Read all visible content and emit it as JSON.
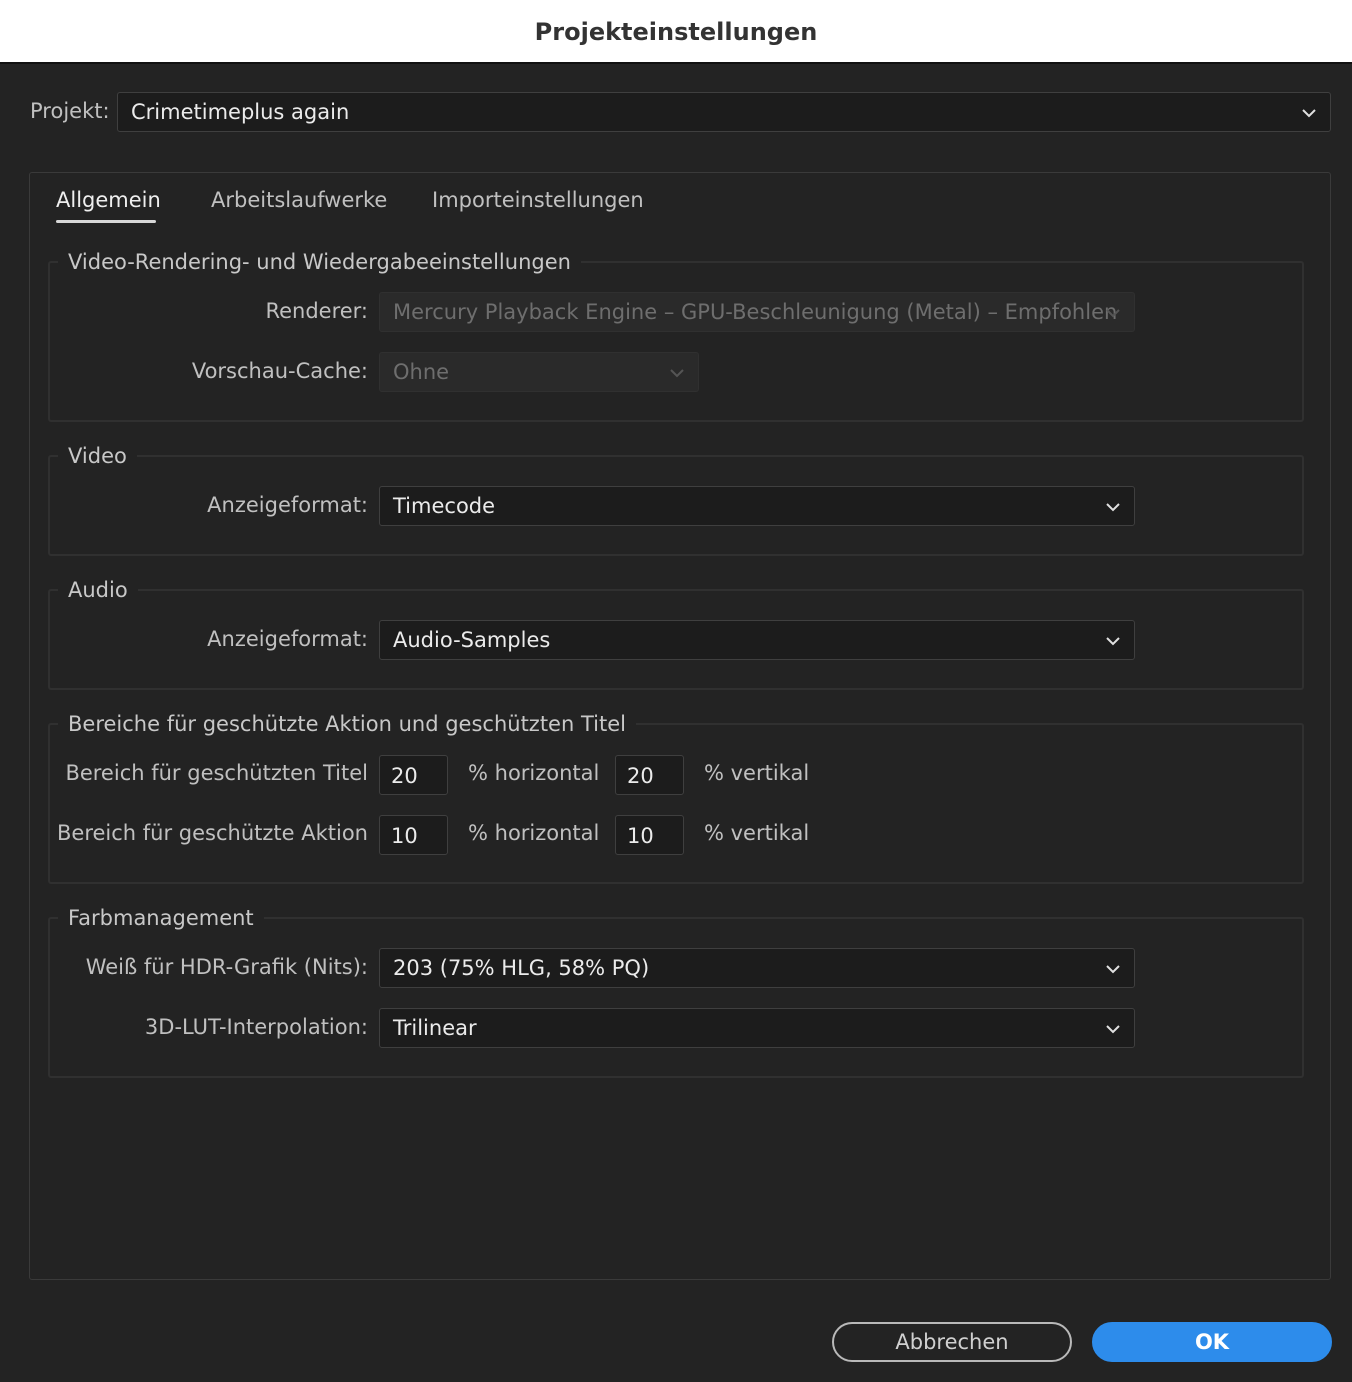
{
  "window": {
    "title": "Projekteinstellungen"
  },
  "project": {
    "label": "Projekt:",
    "value": "Crimetimeplus again"
  },
  "tabs": [
    {
      "label": "Allgemein"
    },
    {
      "label": "Arbeitslaufwerke"
    },
    {
      "label": "Importeinstellungen"
    }
  ],
  "rendering": {
    "legend": "Video-Rendering- und Wiedergabeeinstellungen",
    "renderer_label": "Renderer:",
    "renderer_value": "Mercury Playback Engine – GPU-Beschleunigung (Metal) – Empfohlen",
    "cache_label": "Vorschau-Cache:",
    "cache_value": "Ohne"
  },
  "video": {
    "legend": "Video",
    "format_label": "Anzeigeformat:",
    "format_value": "Timecode"
  },
  "audio": {
    "legend": "Audio",
    "format_label": "Anzeigeformat:",
    "format_value": "Audio-Samples"
  },
  "safe": {
    "legend": "Bereiche für geschützte Aktion und geschützten Titel",
    "title_label": "Bereich für geschützten Titel",
    "title_h": "20",
    "title_v": "20",
    "action_label": "Bereich für geschützte Aktion",
    "action_h": "10",
    "action_v": "10",
    "h_suffix": "% horizontal",
    "v_suffix": "% vertikal"
  },
  "color": {
    "legend": "Farbmanagement",
    "hdr_label": "Weiß für HDR-Grafik (Nits):",
    "hdr_value": "203 (75% HLG, 58% PQ)",
    "lut_label": "3D-LUT-Interpolation:",
    "lut_value": "Trilinear"
  },
  "buttons": {
    "cancel": "Abbrechen",
    "ok": "OK"
  },
  "colors": {
    "accent": "#2d8ceb",
    "background": "#232323",
    "field": "#1c1c1c"
  },
  "icons": {
    "dropdown": "chevron-down-icon"
  }
}
